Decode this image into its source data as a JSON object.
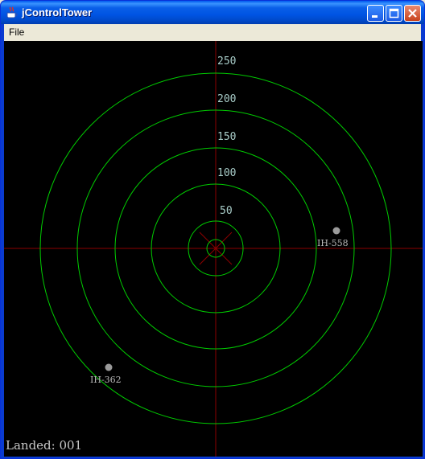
{
  "window": {
    "title": "jControlTower"
  },
  "menu": {
    "file_label": "File"
  },
  "radar": {
    "range_labels": [
      "250",
      "200",
      "150",
      "100",
      "50"
    ],
    "planes": [
      {
        "id": "IH-558",
        "color": "#9A9A9A"
      },
      {
        "id": "IH-362",
        "color": "#9A9A9A"
      }
    ],
    "landed_text": "Landed: 001",
    "colors": {
      "ring": "#00CC00",
      "axis": "#8B0000",
      "background": "#000000"
    }
  }
}
